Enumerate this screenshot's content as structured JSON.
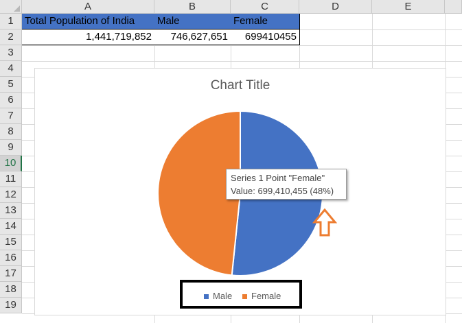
{
  "sheet": {
    "columns": [
      "A",
      "B",
      "C",
      "D",
      "E"
    ],
    "rows": [
      "1",
      "2",
      "3",
      "4",
      "5",
      "6",
      "7",
      "8",
      "9",
      "10",
      "11",
      "12",
      "13",
      "14",
      "15",
      "16",
      "17",
      "18",
      "19"
    ],
    "selected_row": "10",
    "cells": {
      "a1": "Total Population of India",
      "b1": "Male",
      "c1": "Female",
      "a2": "1,441,719,852",
      "b2": "746,627,651",
      "c2": "699410455"
    }
  },
  "chart": {
    "title": "Chart Title",
    "legend": [
      {
        "label": "Male",
        "color": "#4472c4"
      },
      {
        "label": "Female",
        "color": "#ed7d31"
      }
    ],
    "tooltip_line1": "Series 1 Point \"Female\"",
    "tooltip_line2": "Value: 699,410,455 (48%)",
    "annotation_color": "#ed7d31"
  },
  "chart_data": {
    "type": "pie",
    "title": "Chart Title",
    "categories": [
      "Male",
      "Female"
    ],
    "values": [
      746627651,
      699410455
    ],
    "colors": [
      "#4472c4",
      "#ed7d31"
    ],
    "legend_position": "bottom"
  }
}
